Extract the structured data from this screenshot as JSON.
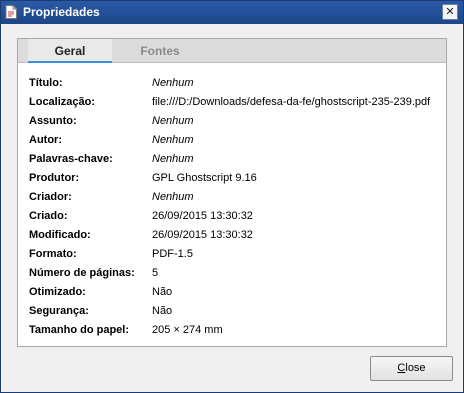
{
  "window": {
    "title": "Propriedades",
    "close_glyph": "✕"
  },
  "tabs": [
    {
      "label": "Geral",
      "active": true
    },
    {
      "label": "Fontes",
      "active": false
    }
  ],
  "properties": [
    {
      "label": "Título:",
      "value": "Nenhum",
      "italic": true
    },
    {
      "label": "Localização:",
      "value": "file:///D:/Downloads/defesa-da-fe/ghostscript-235-239.pdf",
      "italic": false
    },
    {
      "label": "Assunto:",
      "value": "Nenhum",
      "italic": true
    },
    {
      "label": "Autor:",
      "value": "Nenhum",
      "italic": true
    },
    {
      "label": "Palavras-chave:",
      "value": "Nenhum",
      "italic": true
    },
    {
      "label": "Produtor:",
      "value": "GPL Ghostscript 9.16",
      "italic": false
    },
    {
      "label": "Criador:",
      "value": "Nenhum",
      "italic": true
    },
    {
      "label": "Criado:",
      "value": "26/09/2015 13:30:32",
      "italic": false
    },
    {
      "label": "Modificado:",
      "value": "26/09/2015 13:30:32",
      "italic": false
    },
    {
      "label": "Formato:",
      "value": "PDF-1.5",
      "italic": false
    },
    {
      "label": "Número de páginas:",
      "value": "5",
      "italic": false
    },
    {
      "label": "Otimizado:",
      "value": "Não",
      "italic": false
    },
    {
      "label": "Segurança:",
      "value": "Não",
      "italic": false
    },
    {
      "label": "Tamanho do papel:",
      "value": "205 × 274 mm",
      "italic": false
    }
  ],
  "buttons": {
    "close_mnemonic": "C",
    "close_rest": "lose"
  },
  "colors": {
    "titlebar": "#1d4688",
    "tab_active_underline": "#3d8ee0"
  }
}
